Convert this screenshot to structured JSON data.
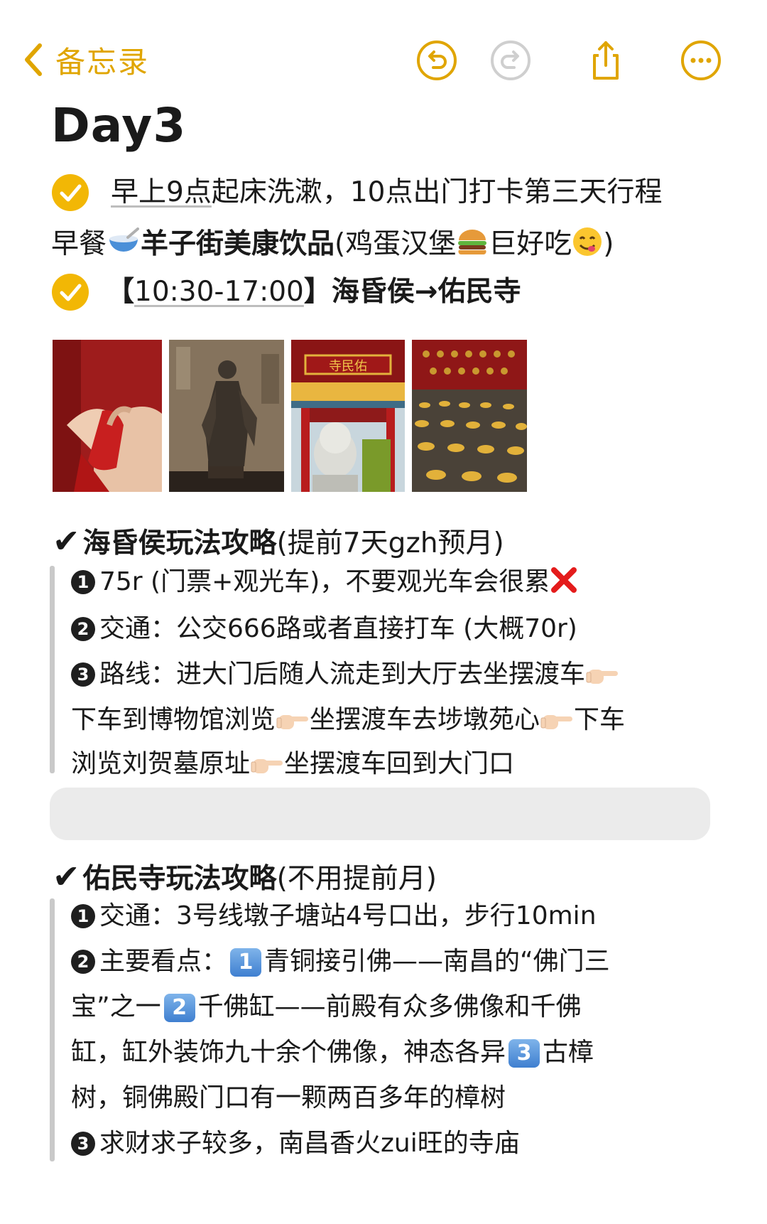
{
  "nav": {
    "back_label": "备忘录",
    "accent": "#e0a500"
  },
  "note": {
    "title": "Day3",
    "line1": "早上9点起床洗漱，10点出门打卡第三天行程",
    "line1_under": "早上9点",
    "line1_rest": "起床洗漱，10点出门打卡第三天行程",
    "breakfast_pre": "早餐",
    "breakfast_bold": "羊子街美康饮品",
    "breakfast_mid": "(鸡蛋汉堡",
    "breakfast_mid2": "巨好吃",
    "breakfast_end": ")",
    "route_open": "【",
    "route_time": "10:30-17:00",
    "route_close": "】",
    "route_text": "海昏侯→佑民寺"
  },
  "photos": [
    {
      "subject": "hands-red-ribbon"
    },
    {
      "subject": "bronze-statue"
    },
    {
      "subject": "youmin-temple-gate",
      "sign": "寺民佑"
    },
    {
      "subject": "gold-coins-display"
    }
  ],
  "section1": {
    "heading_bold": "海昏侯玩法攻略",
    "heading_rest": "(提前7天gzh预月)",
    "n1": "1",
    "item1": "75r (门票+观光车)，不要观光车会很累",
    "n2": "2",
    "item2": "交通：公交666路或者直接打车 (大概70r)",
    "n3": "3",
    "item3_a": "路线：进大门后随人流走到大厅去坐摆渡车",
    "item3_b1": "下车到博物馆浏览",
    "item3_b2": "坐摆渡车去埗墩苑心",
    "item3_b3": "下车",
    "item3_c1": "浏览刘贺墓原址",
    "item3_c2": "坐摆渡车回到大门口"
  },
  "section2": {
    "heading_bold": "佑民寺玩法攻略",
    "heading_rest": "(不用提前月)",
    "n1": "1",
    "item1": "交通：3号线墩子塘站4号口出，步行10min",
    "n2": "2",
    "item2_a": "主要看点：",
    "k1": "1",
    "item2_a2": "青铜接引佛——南昌的“佛门三",
    "item2_b1": "宝”之一",
    "k2": "2",
    "item2_b2": "千佛缸——前殿有众多佛像和千佛",
    "item2_c1": "缸，缸外装饰九十余个佛像，神态各异",
    "k3": "3",
    "item2_c2": "古樟",
    "item2_d": "树，铜佛殿门口有一颗两百多年的樟树",
    "n3": "3",
    "item3": "求财求子较多，南昌香火zui旺的寺庙"
  }
}
